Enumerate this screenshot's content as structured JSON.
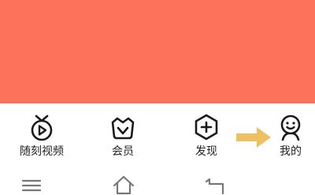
{
  "colors": {
    "banner": "#FD725B",
    "icon": "#1A1A1A",
    "label": "#222222",
    "badge": "#F5305A",
    "arrow": "#EFC062",
    "nav": "#777777"
  },
  "tabbar": {
    "items": [
      {
        "label": "随刻视频",
        "icon": "play-clock-icon"
      },
      {
        "label": "会员",
        "icon": "crown-basket-icon"
      },
      {
        "label": "发现",
        "icon": "plus-hexagon-icon"
      },
      {
        "label": "我的",
        "icon": "smiley-person-icon",
        "badge": true
      }
    ]
  },
  "annotation": {
    "icon": "right-arrow-icon"
  },
  "system_nav": {
    "items": [
      {
        "icon": "menu-icon"
      },
      {
        "icon": "home-icon"
      },
      {
        "icon": "back-icon"
      }
    ]
  }
}
